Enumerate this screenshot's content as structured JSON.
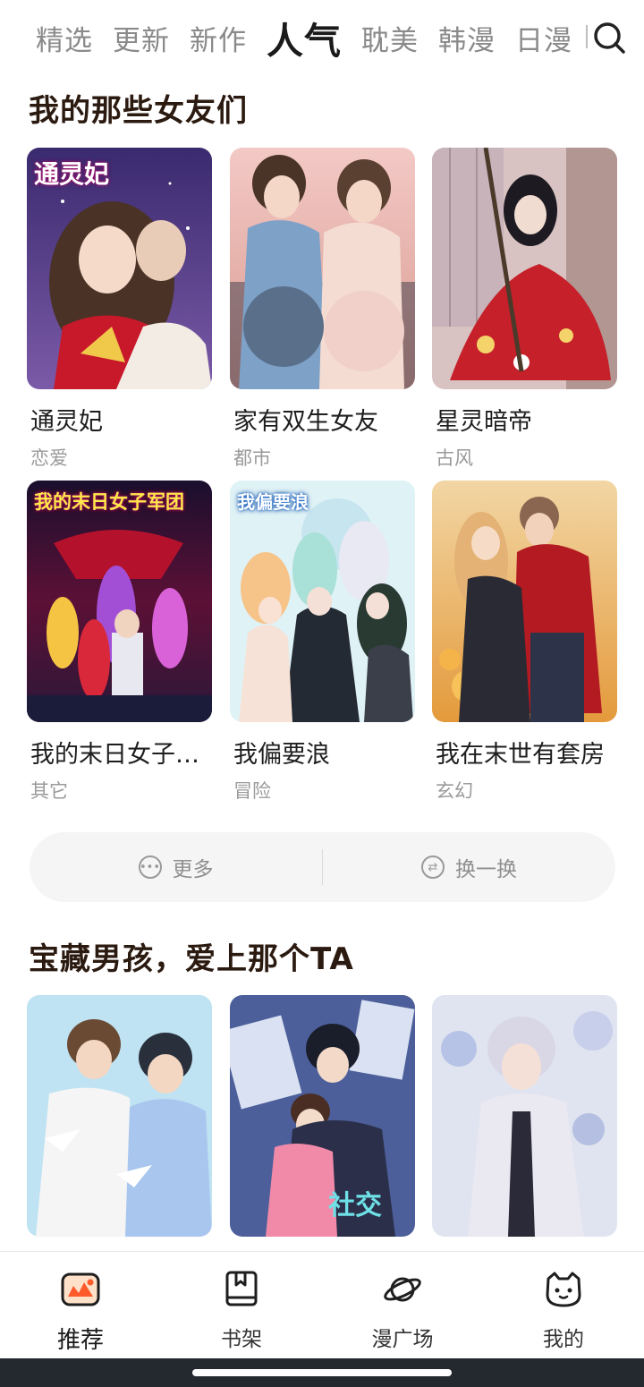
{
  "top_tabs": [
    {
      "label": "精选"
    },
    {
      "label": "更新"
    },
    {
      "label": "新作"
    },
    {
      "label": "人气",
      "active": true
    },
    {
      "label": "耽美"
    },
    {
      "label": "韩漫"
    },
    {
      "label": "日漫"
    }
  ],
  "search": {
    "icon": "search-icon"
  },
  "section1": {
    "title": "我的那些女友们",
    "items": [
      {
        "title": "通灵妃",
        "tag": "恋爱",
        "cover_text": "通灵妃"
      },
      {
        "title": "家有双生女友",
        "tag": "都市"
      },
      {
        "title": "星灵暗帝",
        "tag": "古风"
      },
      {
        "title": "我的末日女子…",
        "tag": "其它",
        "cover_text": "我的末日女子军团"
      },
      {
        "title": "我偏要浪",
        "tag": "冒险",
        "cover_text": "我偏要浪"
      },
      {
        "title": "我在末世有套房",
        "tag": "玄幻"
      }
    ]
  },
  "actions": {
    "more_label": "更多",
    "change_label": "换一换"
  },
  "section2": {
    "title": "宝藏男孩，爱上那个TA"
  },
  "bottom_nav": [
    {
      "label": "推荐",
      "icon": "recommend-icon",
      "active": true
    },
    {
      "label": "书架",
      "icon": "bookshelf-icon"
    },
    {
      "label": "漫广场",
      "icon": "planet-icon"
    },
    {
      "label": "我的",
      "icon": "cat-face-icon"
    }
  ],
  "colors": {
    "accent": "#ff5a2c",
    "title_highlight": "#ffb89a",
    "tag_gray": "#9a9a9a"
  }
}
